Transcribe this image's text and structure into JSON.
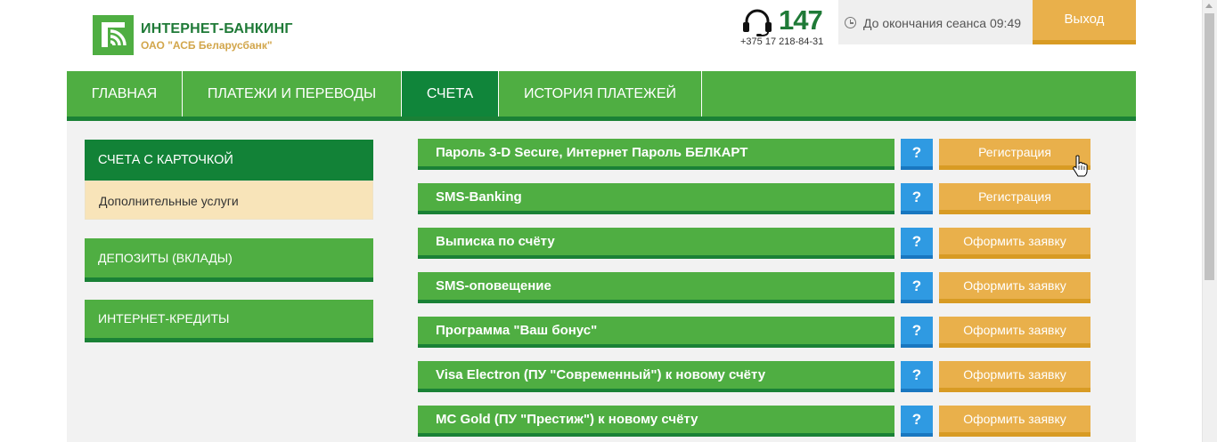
{
  "header": {
    "brand_title": "ИНТЕРНЕТ-БАНКИНГ",
    "brand_subtitle": "ОАО \"АСБ Беларусбанк\"",
    "hotline_number": "147",
    "hotline_phone": "+375 17 218-84-31",
    "session_text": "До окончания сеанса 09:49",
    "logout_label": "Выход",
    "logo_icon": "bank-logo-icon",
    "hotline_icon": "headset-icon",
    "clock_icon": "clock-icon"
  },
  "nav": {
    "items": [
      {
        "label": "ГЛАВНАЯ"
      },
      {
        "label": "ПЛАТЕЖИ И ПЕРЕВОДЫ"
      },
      {
        "label": "СЧЕТА"
      },
      {
        "label": "ИСТОРИЯ ПЛАТЕЖЕЙ"
      }
    ],
    "active_index": 2
  },
  "sidebar": {
    "accounts_label": "СЧЕТА С КАРТОЧКОЙ",
    "accounts_sub_label": "Дополнительные услуги",
    "deposits_label": "ДЕПОЗИТЫ (ВКЛАДЫ)",
    "credits_label": "ИНТЕРНЕТ-КРЕДИТЫ"
  },
  "services": {
    "help_label": "?",
    "rows": [
      {
        "label": "Пароль 3-D Secure, Интернет Пароль БЕЛКАРТ",
        "action": "Регистрация"
      },
      {
        "label": "SMS-Banking",
        "action": "Регистрация"
      },
      {
        "label": "Выписка по счёту",
        "action": "Оформить заявку"
      },
      {
        "label": "SMS-оповещение",
        "action": "Оформить заявку"
      },
      {
        "label": "Программа \"Ваш бонус\"",
        "action": "Оформить заявку"
      },
      {
        "label": "Visa Electron (ПУ \"Современный\") к новому счёту",
        "action": "Оформить заявку"
      },
      {
        "label": "MC Gold (ПУ \"Престиж\") к новому счёту",
        "action": "Оформить заявку"
      }
    ]
  },
  "colors": {
    "green": "#4fae42",
    "dark_green": "#128237",
    "orange": "#e9b04b",
    "blue": "#2f9ae2",
    "sub_bg": "#f8e4b9"
  }
}
